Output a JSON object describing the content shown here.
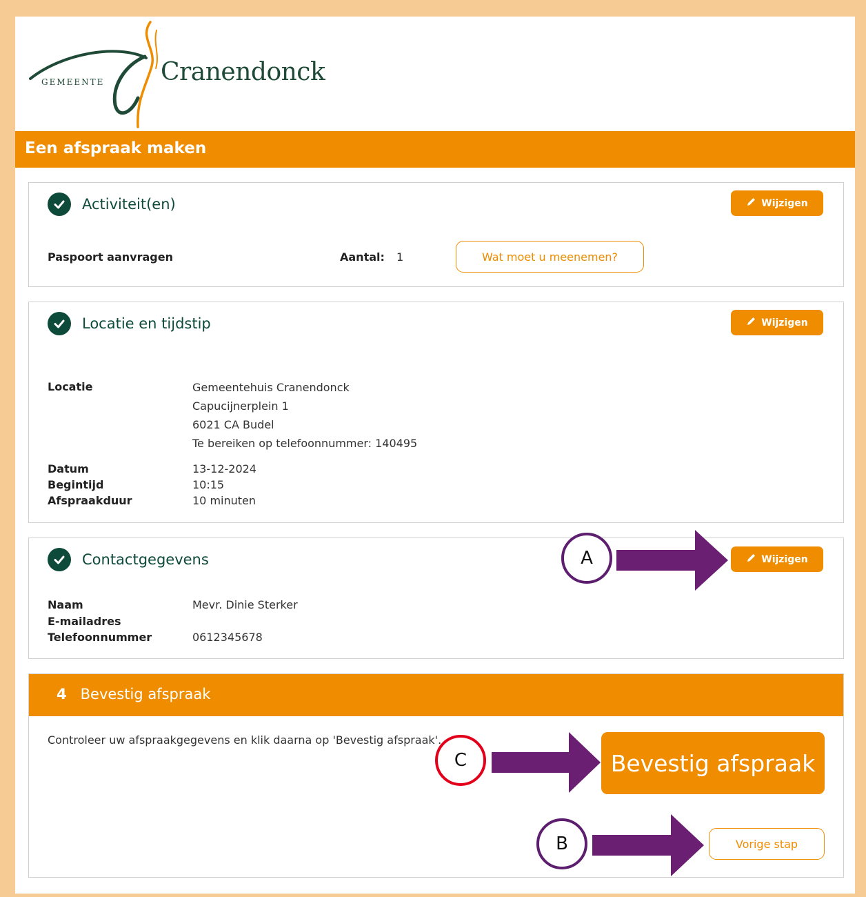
{
  "brand": {
    "gemeente": "GEMEENTE",
    "name": "Cranendonck",
    "colors": {
      "primary": "#ef8c00",
      "dark_green": "#0e4a3a",
      "annotation_purple": "#6a1f73",
      "annotation_red": "#e2001a"
    }
  },
  "page_title": "Een afspraak maken",
  "activiteiten": {
    "title": "Activiteit(en)",
    "edit_label": "Wijzigen",
    "item": "Paspoort aanvragen",
    "count_label": "Aantal:",
    "count_value": "1",
    "info_button": "Wat moet u meenemen?"
  },
  "locatie": {
    "title": "Locatie en tijdstip",
    "edit_label": "Wijzigen",
    "location_label": "Locatie",
    "location_lines": [
      "Gemeentehuis Cranendonck",
      "Capucijnerplein 1",
      "6021 CA Budel",
      "Te bereiken op telefoonnummer: 140495"
    ],
    "date_label": "Datum",
    "date_value": "13-12-2024",
    "start_label": "Begintijd",
    "start_value": "10:15",
    "duration_label": "Afspraakduur",
    "duration_value": "10 minuten"
  },
  "contact": {
    "title": "Contactgegevens",
    "edit_label": "Wijzigen",
    "name_label": "Naam",
    "name_value": "Mevr. Dinie Sterker",
    "email_label": "E-mailadres",
    "email_value": "",
    "phone_label": "Telefoonnummer",
    "phone_value": "0612345678"
  },
  "confirm": {
    "step": "4",
    "title": "Bevestig afspraak",
    "instruction": "Controleer uw afspraakgegevens en klik daarna op 'Bevestig afspraak'.",
    "confirm_button": "Bevestig afspraak",
    "back_button": "Vorige stap"
  },
  "annotations": {
    "a": "A",
    "b": "B",
    "c": "C"
  },
  "icons": {
    "check": "check-circle-icon",
    "edit": "pencil-icon"
  }
}
